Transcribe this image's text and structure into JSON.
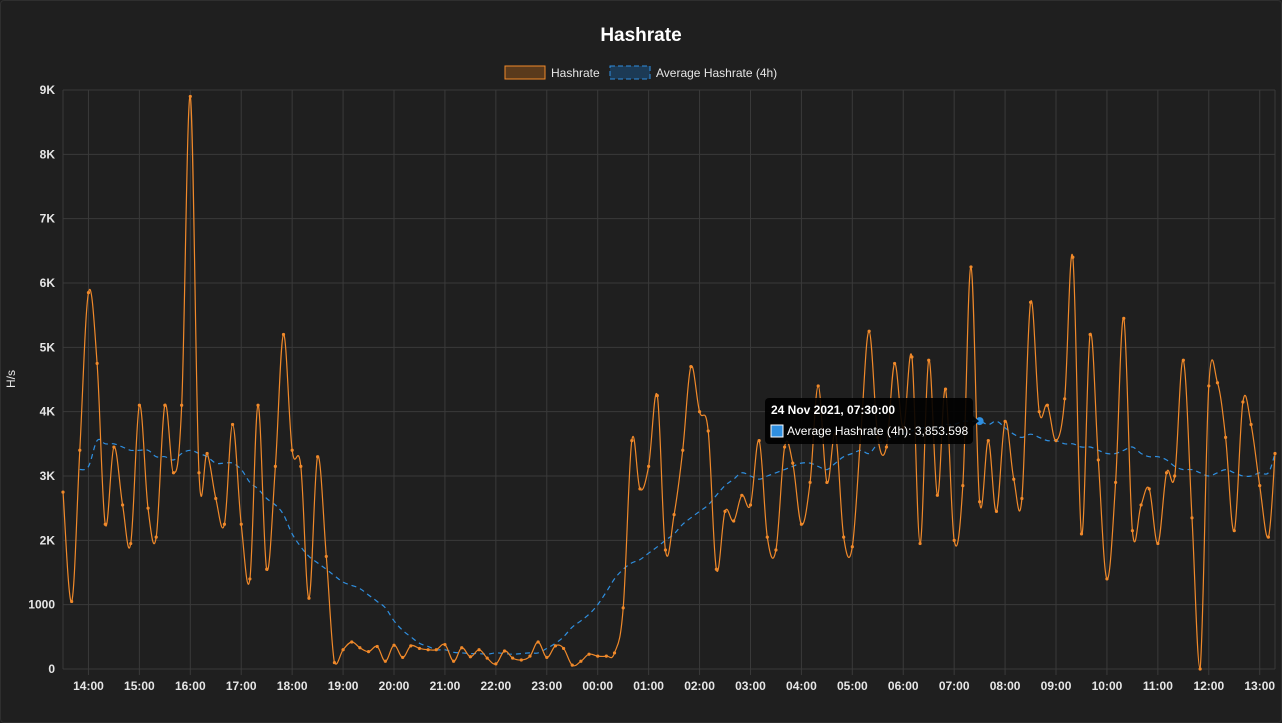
{
  "colors": {
    "background": "#1f1f1f",
    "grid": "#3a3a3a",
    "hashrate": "#f0892a",
    "hashrate_fill": "#5a3a1c",
    "average": "#2f8fe0",
    "tooltip_bg": "#000000"
  },
  "chart_data": {
    "type": "line",
    "title": "Hashrate",
    "xlabel": "",
    "ylabel": "H/s",
    "ylim": [
      0,
      9000
    ],
    "yticks": [
      0,
      1000,
      2000,
      3000,
      4000,
      5000,
      6000,
      7000,
      8000,
      9000
    ],
    "ytick_labels": [
      "0",
      "1000",
      "2K",
      "3K",
      "4K",
      "5K",
      "6K",
      "7K",
      "8K",
      "9K"
    ],
    "xlim_hours": [
      13.5,
      37.3
    ],
    "xticks": [
      14,
      15,
      16,
      17,
      18,
      19,
      20,
      21,
      22,
      23,
      24,
      25,
      26,
      27,
      28,
      29,
      30,
      31,
      32,
      33,
      34,
      35,
      36,
      37
    ],
    "xtick_labels": [
      "14:00",
      "15:00",
      "16:00",
      "17:00",
      "18:00",
      "19:00",
      "20:00",
      "21:00",
      "22:00",
      "23:00",
      "00:00",
      "01:00",
      "02:00",
      "03:00",
      "04:00",
      "05:00",
      "06:00",
      "07:00",
      "08:00",
      "09:00",
      "10:00",
      "11:00",
      "12:00",
      "13:00"
    ],
    "grid": true,
    "legend": "top",
    "series": [
      {
        "name": "Hashrate",
        "style": "solid",
        "points": [
          [
            13.5,
            2750
          ],
          [
            13.67,
            1050
          ],
          [
            13.83,
            3400
          ],
          [
            14.0,
            5850
          ],
          [
            14.17,
            4750
          ],
          [
            14.33,
            2250
          ],
          [
            14.5,
            3450
          ],
          [
            14.67,
            2550
          ],
          [
            14.83,
            1950
          ],
          [
            15.0,
            4100
          ],
          [
            15.17,
            2500
          ],
          [
            15.33,
            2050
          ],
          [
            15.5,
            4100
          ],
          [
            15.67,
            3050
          ],
          [
            15.83,
            4100
          ],
          [
            16.0,
            8900
          ],
          [
            16.17,
            3050
          ],
          [
            16.33,
            3350
          ],
          [
            16.5,
            2650
          ],
          [
            16.67,
            2250
          ],
          [
            16.83,
            3800
          ],
          [
            17.0,
            2250
          ],
          [
            17.17,
            1400
          ],
          [
            17.33,
            4100
          ],
          [
            17.5,
            1550
          ],
          [
            17.67,
            3150
          ],
          [
            17.83,
            5200
          ],
          [
            18.0,
            3400
          ],
          [
            18.17,
            3150
          ],
          [
            18.33,
            1100
          ],
          [
            18.5,
            3300
          ],
          [
            18.67,
            1750
          ],
          [
            18.83,
            100
          ],
          [
            19.0,
            300
          ],
          [
            19.17,
            420
          ],
          [
            19.33,
            330
          ],
          [
            19.5,
            270
          ],
          [
            19.67,
            350
          ],
          [
            19.83,
            120
          ],
          [
            20.0,
            370
          ],
          [
            20.17,
            180
          ],
          [
            20.33,
            360
          ],
          [
            20.5,
            320
          ],
          [
            20.67,
            300
          ],
          [
            20.83,
            300
          ],
          [
            21.0,
            380
          ],
          [
            21.17,
            120
          ],
          [
            21.33,
            330
          ],
          [
            21.5,
            190
          ],
          [
            21.67,
            300
          ],
          [
            21.83,
            170
          ],
          [
            22.0,
            80
          ],
          [
            22.17,
            280
          ],
          [
            22.33,
            170
          ],
          [
            22.5,
            140
          ],
          [
            22.67,
            200
          ],
          [
            22.83,
            420
          ],
          [
            23.0,
            180
          ],
          [
            23.17,
            360
          ],
          [
            23.33,
            320
          ],
          [
            23.5,
            60
          ],
          [
            23.67,
            120
          ],
          [
            23.83,
            230
          ],
          [
            24.0,
            200
          ],
          [
            24.17,
            200
          ],
          [
            24.33,
            250
          ],
          [
            24.5,
            950
          ],
          [
            24.67,
            3550
          ],
          [
            24.83,
            2800
          ],
          [
            25.0,
            3150
          ],
          [
            25.17,
            4250
          ],
          [
            25.33,
            1850
          ],
          [
            25.5,
            2400
          ],
          [
            25.67,
            3400
          ],
          [
            25.83,
            4700
          ],
          [
            26.0,
            4000
          ],
          [
            26.17,
            3700
          ],
          [
            26.33,
            1550
          ],
          [
            26.5,
            2450
          ],
          [
            26.67,
            2300
          ],
          [
            26.83,
            2700
          ],
          [
            27.0,
            2550
          ],
          [
            27.17,
            3550
          ],
          [
            27.33,
            2050
          ],
          [
            27.5,
            1850
          ],
          [
            27.67,
            3450
          ],
          [
            27.83,
            3200
          ],
          [
            28.0,
            2250
          ],
          [
            28.17,
            2900
          ],
          [
            28.33,
            4400
          ],
          [
            28.5,
            2900
          ],
          [
            28.67,
            3650
          ],
          [
            28.83,
            2050
          ],
          [
            29.0,
            1900
          ],
          [
            29.17,
            3700
          ],
          [
            29.33,
            5250
          ],
          [
            29.5,
            3600
          ],
          [
            29.67,
            3450
          ],
          [
            29.83,
            4750
          ],
          [
            30.0,
            3750
          ],
          [
            30.17,
            4850
          ],
          [
            30.33,
            1950
          ],
          [
            30.5,
            4800
          ],
          [
            30.67,
            2700
          ],
          [
            30.83,
            4350
          ],
          [
            31.0,
            2000
          ],
          [
            31.17,
            2850
          ],
          [
            31.33,
            6250
          ],
          [
            31.5,
            2600
          ],
          [
            31.67,
            3550
          ],
          [
            31.83,
            2450
          ],
          [
            32.0,
            3850
          ],
          [
            32.17,
            2950
          ],
          [
            32.33,
            2650
          ],
          [
            32.5,
            5700
          ],
          [
            32.67,
            4000
          ],
          [
            32.83,
            4100
          ],
          [
            33.0,
            3550
          ],
          [
            33.17,
            4200
          ],
          [
            33.33,
            6400
          ],
          [
            33.5,
            2100
          ],
          [
            33.67,
            5200
          ],
          [
            33.83,
            3250
          ],
          [
            34.0,
            1400
          ],
          [
            34.17,
            2900
          ],
          [
            34.33,
            5450
          ],
          [
            34.5,
            2150
          ],
          [
            34.67,
            2550
          ],
          [
            34.83,
            2800
          ],
          [
            35.0,
            1950
          ],
          [
            35.17,
            3050
          ],
          [
            35.33,
            3000
          ],
          [
            35.5,
            4800
          ],
          [
            35.67,
            2350
          ],
          [
            35.83,
            0
          ],
          [
            36.0,
            4400
          ],
          [
            36.17,
            4450
          ],
          [
            36.33,
            3600
          ],
          [
            36.5,
            2150
          ],
          [
            36.67,
            4150
          ],
          [
            36.83,
            3800
          ],
          [
            37.0,
            2850
          ],
          [
            37.17,
            2050
          ],
          [
            37.3,
            3350
          ]
        ]
      },
      {
        "name": "Average Hashrate (4h)",
        "style": "dashed",
        "points": [
          [
            13.83,
            3100
          ],
          [
            14.0,
            3150
          ],
          [
            14.17,
            3550
          ],
          [
            14.33,
            3500
          ],
          [
            14.5,
            3500
          ],
          [
            14.67,
            3450
          ],
          [
            14.83,
            3400
          ],
          [
            15.0,
            3400
          ],
          [
            15.17,
            3400
          ],
          [
            15.33,
            3300
          ],
          [
            15.5,
            3300
          ],
          [
            15.67,
            3250
          ],
          [
            15.83,
            3350
          ],
          [
            16.0,
            3400
          ],
          [
            16.17,
            3350
          ],
          [
            16.33,
            3300
          ],
          [
            16.5,
            3200
          ],
          [
            16.67,
            3200
          ],
          [
            16.83,
            3200
          ],
          [
            17.0,
            3100
          ],
          [
            17.17,
            2900
          ],
          [
            17.33,
            2800
          ],
          [
            17.5,
            2650
          ],
          [
            17.67,
            2550
          ],
          [
            17.83,
            2400
          ],
          [
            18.0,
            2100
          ],
          [
            18.17,
            1900
          ],
          [
            18.33,
            1750
          ],
          [
            18.5,
            1650
          ],
          [
            18.67,
            1550
          ],
          [
            18.83,
            1450
          ],
          [
            19.0,
            1350
          ],
          [
            19.17,
            1300
          ],
          [
            19.33,
            1250
          ],
          [
            19.5,
            1150
          ],
          [
            19.67,
            1050
          ],
          [
            19.83,
            950
          ],
          [
            20.0,
            750
          ],
          [
            20.17,
            600
          ],
          [
            20.33,
            500
          ],
          [
            20.5,
            400
          ],
          [
            20.67,
            350
          ],
          [
            20.83,
            300
          ],
          [
            21.0,
            300
          ],
          [
            21.17,
            260
          ],
          [
            21.33,
            250
          ],
          [
            21.5,
            240
          ],
          [
            21.67,
            240
          ],
          [
            21.83,
            230
          ],
          [
            22.0,
            250
          ],
          [
            22.17,
            240
          ],
          [
            22.33,
            230
          ],
          [
            22.5,
            240
          ],
          [
            22.67,
            250
          ],
          [
            22.83,
            250
          ],
          [
            23.0,
            320
          ],
          [
            23.17,
            400
          ],
          [
            23.33,
            500
          ],
          [
            23.5,
            650
          ],
          [
            23.67,
            750
          ],
          [
            23.83,
            850
          ],
          [
            24.0,
            1000
          ],
          [
            24.17,
            1200
          ],
          [
            24.33,
            1400
          ],
          [
            24.5,
            1550
          ],
          [
            24.67,
            1650
          ],
          [
            24.83,
            1700
          ],
          [
            25.0,
            1800
          ],
          [
            25.17,
            1900
          ],
          [
            25.33,
            2000
          ],
          [
            25.5,
            2100
          ],
          [
            25.67,
            2250
          ],
          [
            25.83,
            2350
          ],
          [
            26.0,
            2450
          ],
          [
            26.17,
            2550
          ],
          [
            26.33,
            2700
          ],
          [
            26.5,
            2850
          ],
          [
            26.67,
            2950
          ],
          [
            26.83,
            3050
          ],
          [
            27.0,
            3000
          ],
          [
            27.17,
            2950
          ],
          [
            27.33,
            3000
          ],
          [
            27.5,
            3050
          ],
          [
            27.67,
            3100
          ],
          [
            27.83,
            3150
          ],
          [
            28.0,
            3200
          ],
          [
            28.17,
            3200
          ],
          [
            28.33,
            3150
          ],
          [
            28.5,
            3100
          ],
          [
            28.67,
            3200
          ],
          [
            28.83,
            3300
          ],
          [
            29.0,
            3350
          ],
          [
            29.17,
            3400
          ],
          [
            29.33,
            3350
          ],
          [
            29.5,
            3500
          ],
          [
            29.67,
            3550
          ],
          [
            29.83,
            3600
          ],
          [
            30.0,
            3650
          ],
          [
            30.17,
            3700
          ],
          [
            30.33,
            3750
          ],
          [
            30.5,
            3750
          ],
          [
            30.67,
            3750
          ],
          [
            30.83,
            3800
          ],
          [
            31.0,
            3800
          ],
          [
            31.17,
            3850
          ],
          [
            31.33,
            3850
          ],
          [
            31.5,
            3853.598
          ],
          [
            31.67,
            3800
          ],
          [
            31.83,
            3850
          ],
          [
            32.0,
            3750
          ],
          [
            32.17,
            3650
          ],
          [
            32.33,
            3600
          ],
          [
            32.5,
            3650
          ],
          [
            32.67,
            3600
          ],
          [
            32.83,
            3550
          ],
          [
            33.0,
            3550
          ],
          [
            33.17,
            3500
          ],
          [
            33.33,
            3500
          ],
          [
            33.5,
            3450
          ],
          [
            33.67,
            3450
          ],
          [
            33.83,
            3400
          ],
          [
            34.0,
            3350
          ],
          [
            34.17,
            3350
          ],
          [
            34.33,
            3400
          ],
          [
            34.5,
            3450
          ],
          [
            34.67,
            3350
          ],
          [
            34.83,
            3300
          ],
          [
            35.0,
            3300
          ],
          [
            35.17,
            3250
          ],
          [
            35.33,
            3150
          ],
          [
            35.5,
            3100
          ],
          [
            35.67,
            3100
          ],
          [
            35.83,
            3050
          ],
          [
            36.0,
            3000
          ],
          [
            36.17,
            3050
          ],
          [
            36.33,
            3100
          ],
          [
            36.5,
            3050
          ],
          [
            36.67,
            3000
          ],
          [
            36.83,
            3000
          ],
          [
            37.0,
            3050
          ],
          [
            37.17,
            3050
          ],
          [
            37.3,
            3350
          ]
        ]
      }
    ],
    "tooltip": {
      "x_hours": 31.5,
      "title": "24 Nov 2021, 07:30:00",
      "label": "Average Hashrate (4h): 3,853.598"
    }
  }
}
